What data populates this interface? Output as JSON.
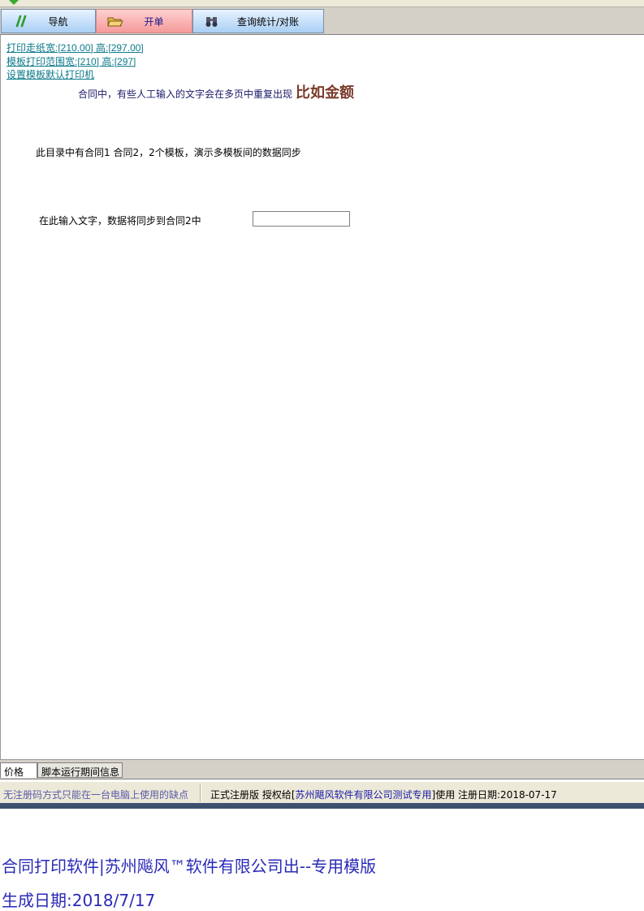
{
  "tabs": {
    "nav": "导航",
    "open": "开单",
    "query": "查询统计/对账"
  },
  "links": {
    "paper_size": "打印走纸宽:[210.00] 高:[297.00]",
    "template_range": "模板打印范围宽:[210] 高:[297]",
    "default_printer": "设置模板默认打印机"
  },
  "content": {
    "note": "合同中，有些人工输入的文字会在多页中重复出现",
    "note_big": "比如金额",
    "description": "此目录中有合同1 合同2，2个模板，演示多模板间的数据同步",
    "input_label": "在此输入文字，数据将同步到合同2中",
    "input_value": ""
  },
  "bottom_tabs": {
    "price": "价格",
    "info": "脚本运行期间信息"
  },
  "status": {
    "left": "无注册码方式只能在一台电脑上使用的缺点",
    "edition": "正式注册版 授权给[",
    "licensee": "苏州飓风软件有限公司测试专用",
    "tail": "]使用 注册日期:2018-07-17"
  },
  "footer": {
    "line1": "合同打印软件|苏州飚风™软件有限公司出--专用模版",
    "line2": "生成日期:2018/7/17"
  },
  "icons": {
    "nav": "green-slash-icon",
    "open": "open-folder-icon",
    "query": "binoculars-icon"
  },
  "colors": {
    "accent_link": "#0d7a8a",
    "open_tab": "#f59a9a",
    "footer_text": "#2a2ab8"
  }
}
